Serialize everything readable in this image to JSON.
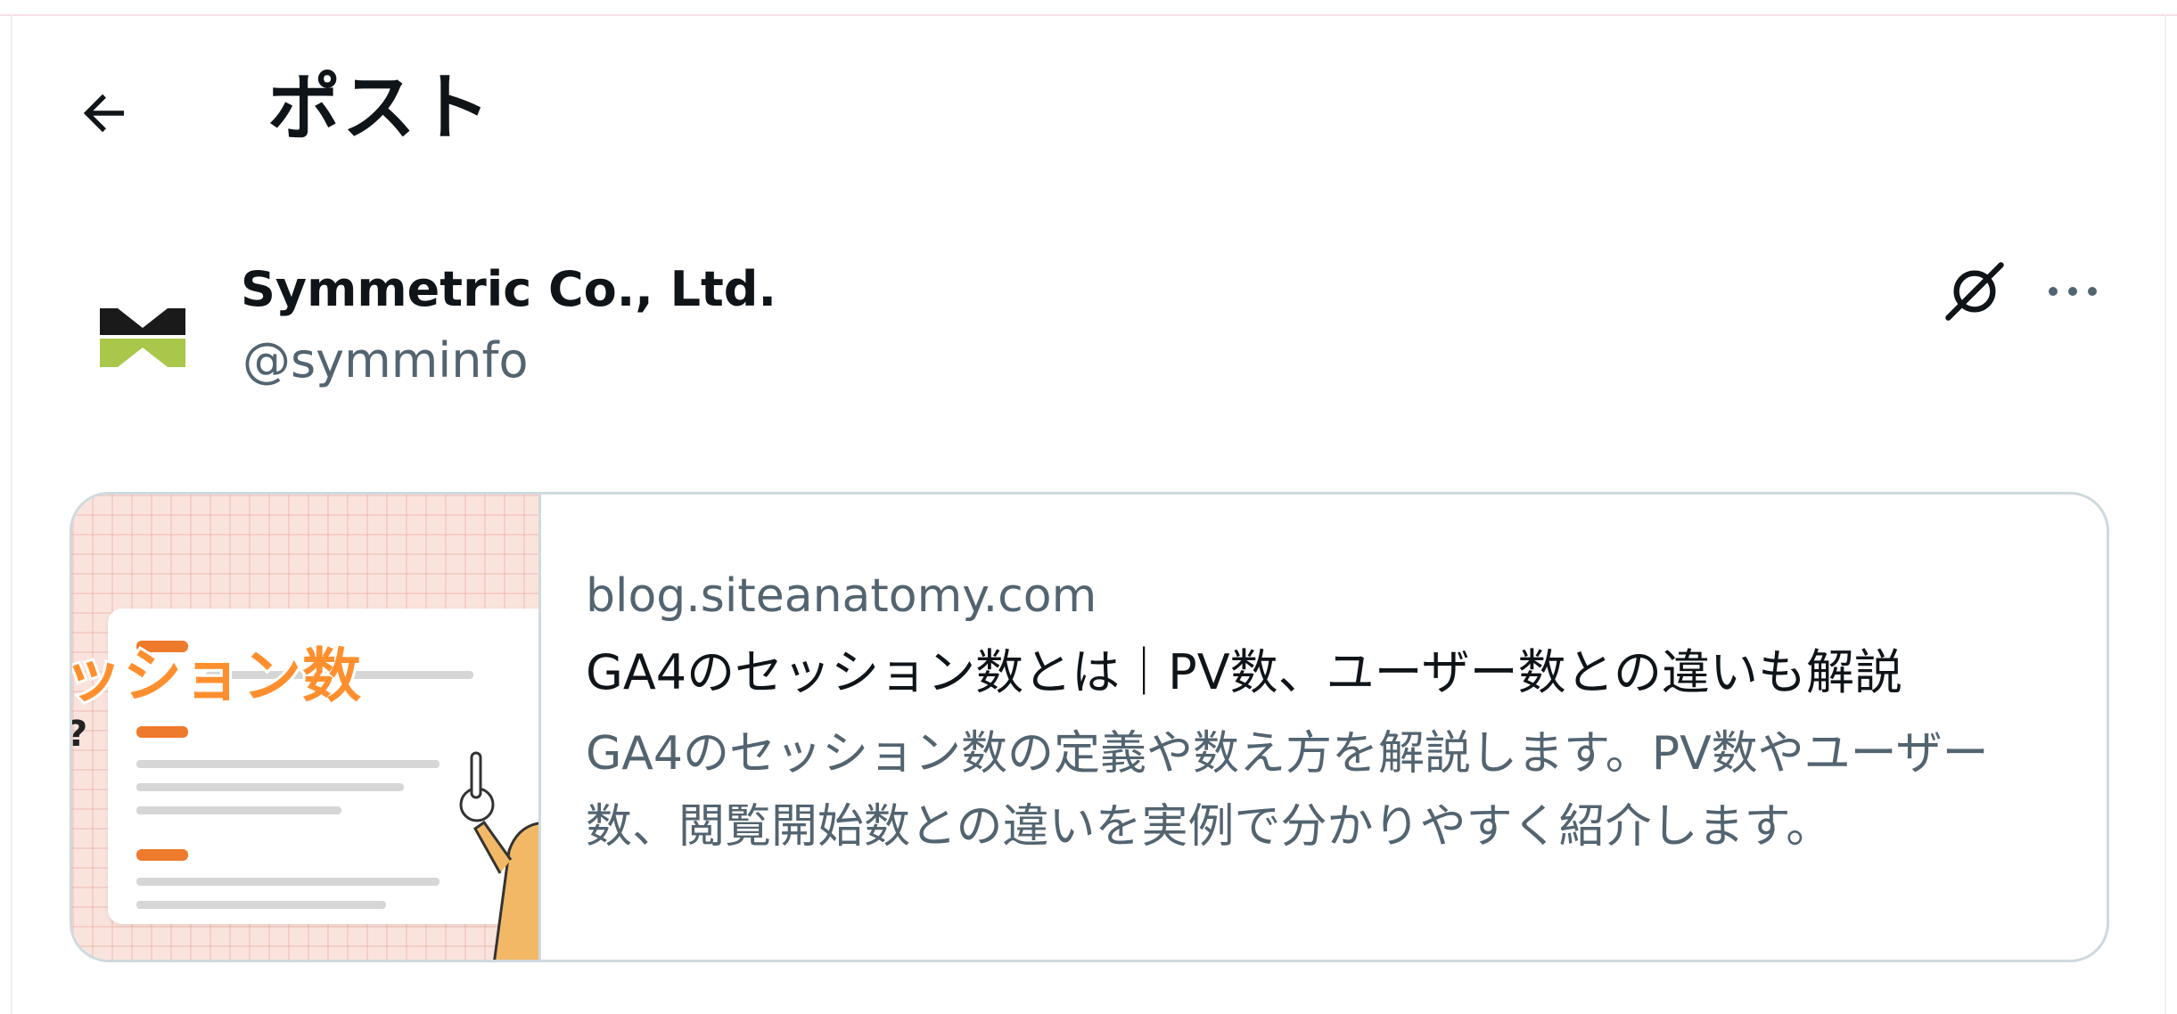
{
  "header": {
    "title": "ポスト",
    "back_icon": "arrow-left-icon"
  },
  "author": {
    "name": "Symmetric Co., Ltd.",
    "handle": "@symminfo",
    "avatar_colors": {
      "dark": "#1a1a1a",
      "green": "#a9c74a"
    }
  },
  "actions": {
    "grok_icon": "grok-icon",
    "more_icon": "more-horizontal-icon"
  },
  "link_card": {
    "domain": "blog.siteanatomy.com",
    "title": "GA4のセッション数とは｜PV数、ユーザー数との違いも解説",
    "description": "GA4のセッション数の定義や数え方を解説します。PV数やユーザー数、閲覧開始数との違いを実例で分かりやすく紹介します。",
    "thumbnail": {
      "title_text": "ッション数",
      "question_mark": "?",
      "accent_color": "#ff8f2e"
    }
  },
  "colors": {
    "primary_text": "#0f1419",
    "secondary_text": "#536471",
    "border": "#cfd9de"
  }
}
